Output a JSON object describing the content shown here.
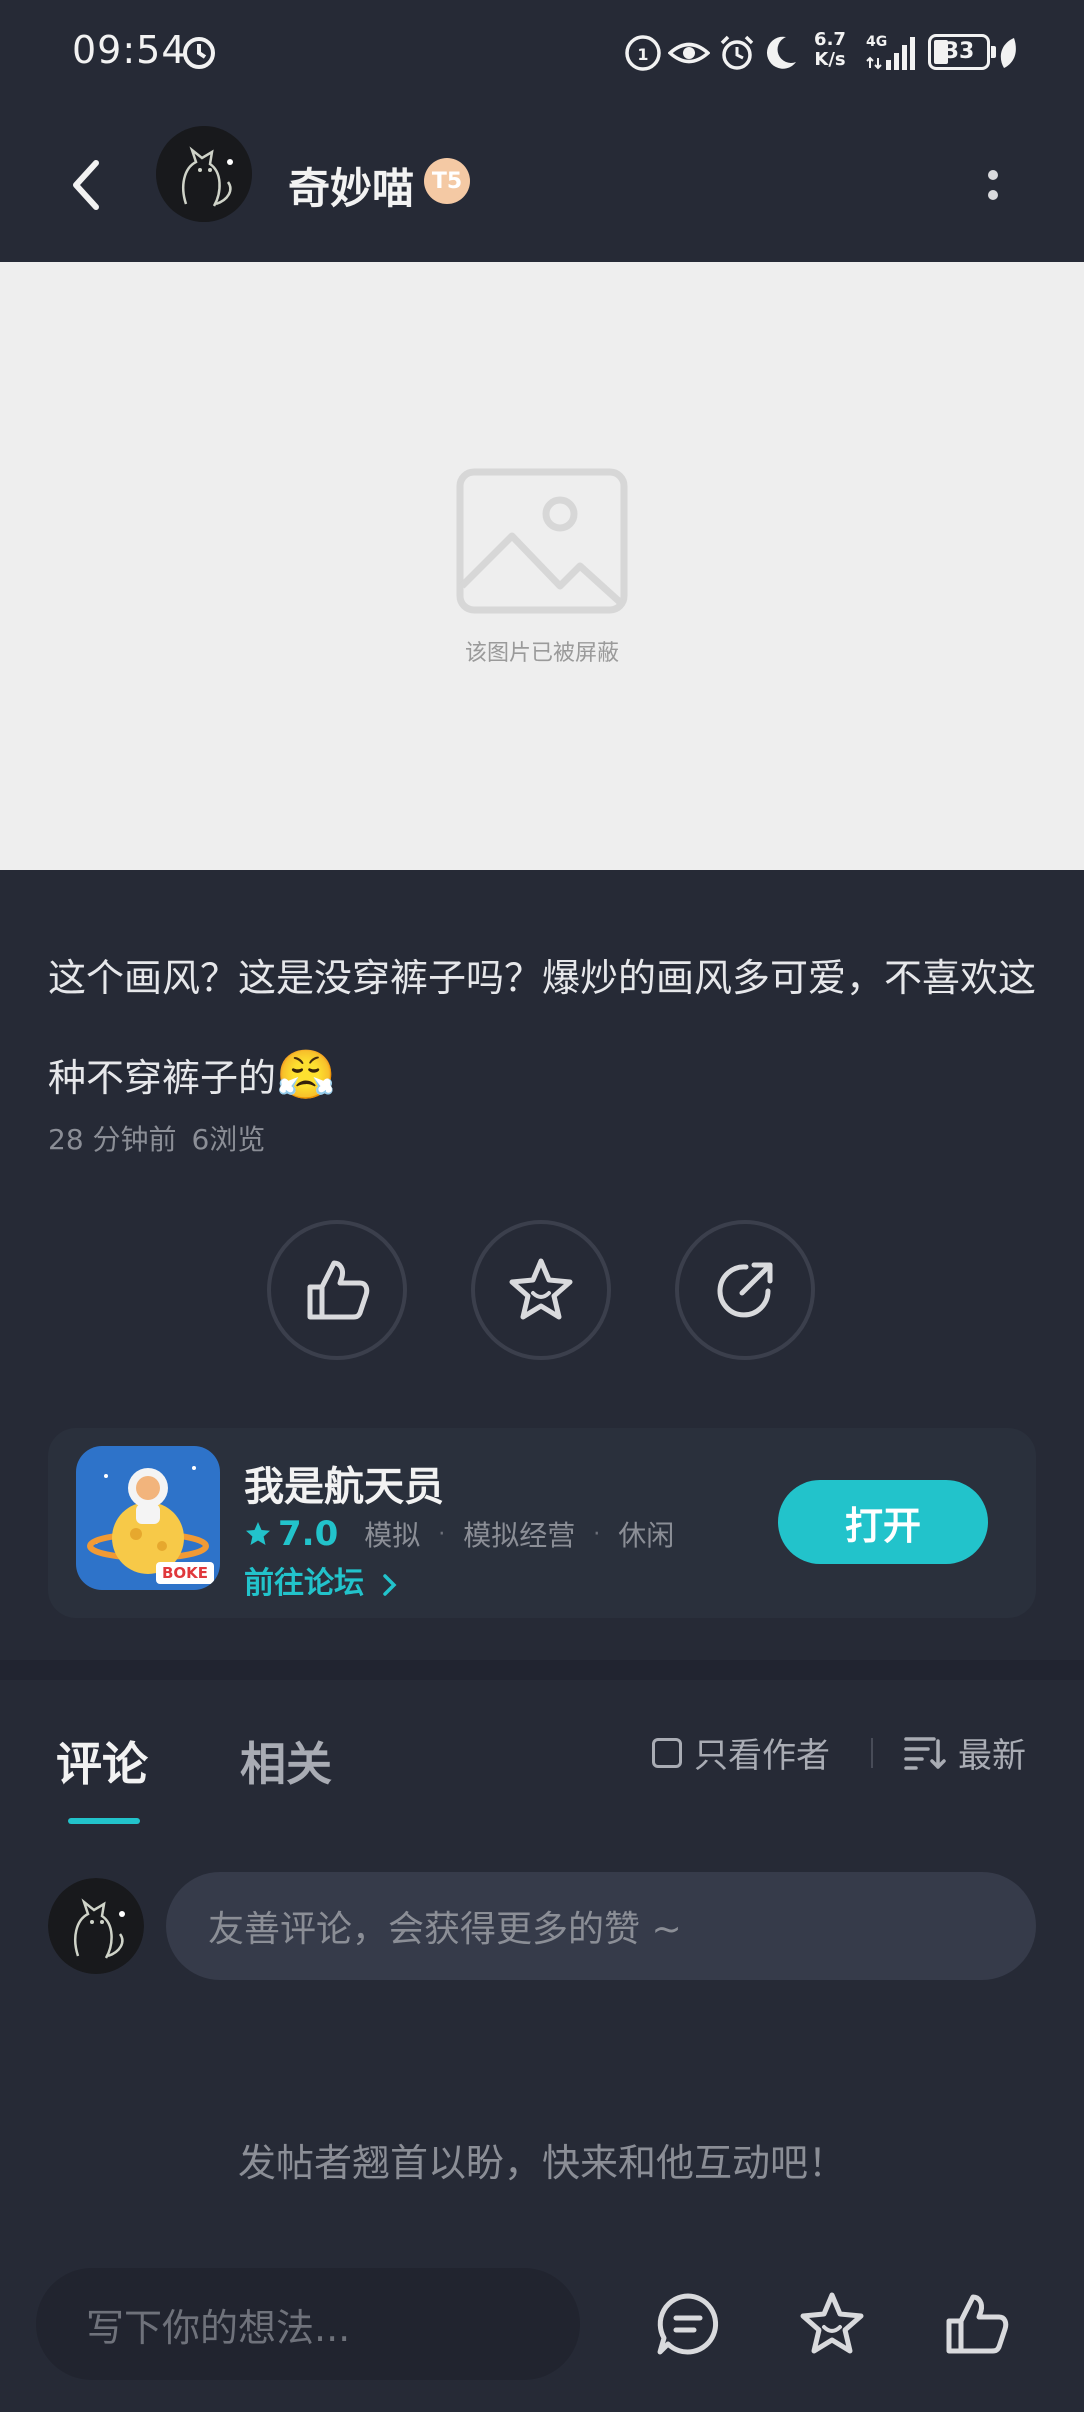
{
  "status_bar": {
    "time": "09:54",
    "net_speed_value": "6.7",
    "net_speed_unit": "K/s",
    "network": "4G",
    "battery": "33",
    "icons": [
      "timer-icon",
      "hd-call-icon",
      "eye-comfort-icon",
      "alarm-icon",
      "moon-icon",
      "signal-icon",
      "battery-icon",
      "leaf-icon"
    ]
  },
  "header": {
    "author_name": "奇妙喵",
    "badge": "T5",
    "back_icon": "back-arrow-icon",
    "more_icon": "more-vertical-icon"
  },
  "post": {
    "blocked_image_text": "该图片已被屏蔽",
    "text": "这个画风？这是没穿裤子吗？爆炒的画风多可爱，不喜欢这种不穿裤子的",
    "emoji": "😤",
    "time_ago": "28 分钟前",
    "views": "6浏览"
  },
  "actions": {
    "like_icon": "thumbs-up-icon",
    "favorite_icon": "star-icon",
    "share_icon": "share-icon"
  },
  "game_card": {
    "name": "我是航天员",
    "rating": "7.0",
    "tags": [
      "模拟",
      "模拟经营",
      "休闲"
    ],
    "forum_link": "前往论坛",
    "open_label": "打开",
    "icon_badge": "BOKE"
  },
  "comments": {
    "tabs": [
      "评论",
      "相关"
    ],
    "author_only": "只看作者",
    "sort": "最新",
    "input_placeholder": "友善评论，会获得更多的赞 ~",
    "empty_text": "发帖者翘首以盼，快来和他互动吧！"
  },
  "bottom_bar": {
    "placeholder": "写下你的想法...",
    "comment_icon": "comment-icon",
    "favorite_icon": "star-icon",
    "like_icon": "thumbs-up-icon"
  },
  "colors": {
    "background": "#262a36",
    "accent": "#22c3cb",
    "card": "#2a303c"
  }
}
